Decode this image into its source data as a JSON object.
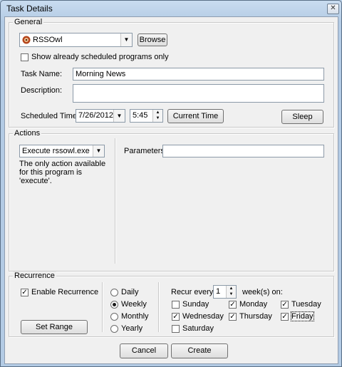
{
  "window": {
    "title": "Task Details",
    "close_glyph": "✕"
  },
  "general": {
    "legend": "General",
    "program_value": "RSSOwl",
    "browse_label": "Browse",
    "show_scheduled_label": "Show already scheduled programs only",
    "show_scheduled_checked": false,
    "task_name_label": "Task Name:",
    "task_name_value": "Morning News",
    "description_label": "Description:",
    "description_value": "",
    "scheduled_time_label": "Scheduled Time:",
    "date_value": "7/26/2012",
    "time_value": "5:45",
    "current_time_label": "Current Time",
    "sleep_label": "Sleep"
  },
  "actions": {
    "legend": "Actions",
    "action_value": "Execute rssowl.exe",
    "note": "The only action available for this program is 'execute'.",
    "parameters_label": "Parameters:",
    "parameters_value": ""
  },
  "recurrence": {
    "legend": "Recurrence",
    "enable_label": "Enable Recurrence",
    "enable_checked": true,
    "set_range_label": "Set Range",
    "frequency_options": [
      {
        "label": "Daily",
        "selected": false
      },
      {
        "label": "Weekly",
        "selected": true
      },
      {
        "label": "Monthly",
        "selected": false
      },
      {
        "label": "Yearly",
        "selected": false
      }
    ],
    "recur_every_label": "Recur every",
    "recur_every_value": "1",
    "weeks_on_label": "week(s) on:",
    "days": [
      {
        "label": "Sunday",
        "checked": false
      },
      {
        "label": "Monday",
        "checked": true
      },
      {
        "label": "Tuesday",
        "checked": true
      },
      {
        "label": "Wednesday",
        "checked": true
      },
      {
        "label": "Thursday",
        "checked": true
      },
      {
        "label": "Friday",
        "checked": true
      },
      {
        "label": "Saturday",
        "checked": false
      }
    ]
  },
  "footer": {
    "cancel_label": "Cancel",
    "create_label": "Create"
  }
}
